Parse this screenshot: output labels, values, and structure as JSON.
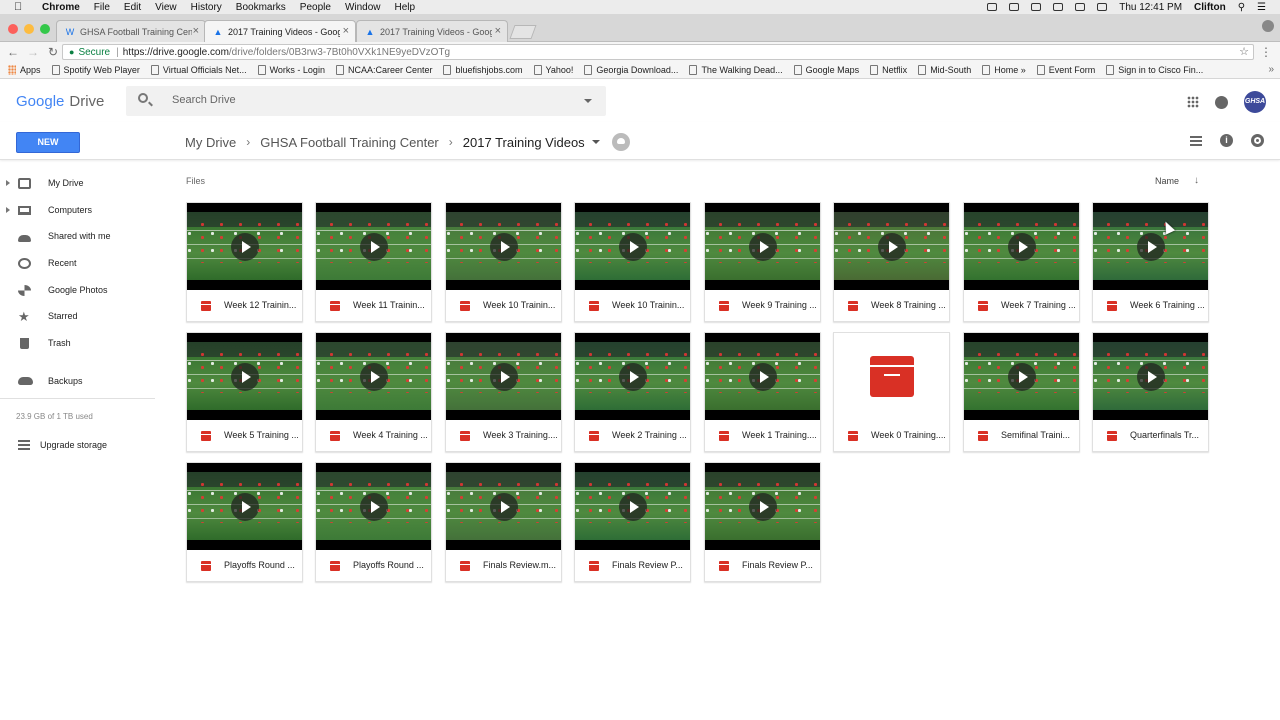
{
  "mac_menubar": {
    "app": "Chrome",
    "items": [
      "File",
      "Edit",
      "View",
      "History",
      "Bookmarks",
      "People",
      "Window",
      "Help"
    ],
    "clock": "Thu 12:41 PM",
    "user": "Clifton"
  },
  "browser": {
    "tabs": [
      {
        "label": "GHSA Football Training Center",
        "active": false
      },
      {
        "label": "2017 Training Videos - Google Drive",
        "active": true
      },
      {
        "label": "2017 Training Videos - Google Drive",
        "active": false
      }
    ],
    "secure_label": "Secure",
    "url_host": "https://drive.google.com",
    "url_path": "/drive/folders/0B3rw3-7Bt0h0VXk1NE9yeDVzOTg"
  },
  "bookmarks": [
    "Apps",
    "Spotify Web Player",
    "Virtual Officials Net...",
    "Works - Login",
    "NCAA:Career Center",
    "bluefishjobs.com",
    "Yahoo!",
    "Georgia Download...",
    "The Walking Dead...",
    "Google Maps",
    "Netflix",
    "Mid-South",
    "Home »",
    "Event Form",
    "Sign in to Cisco Fin..."
  ],
  "drive": {
    "logo_google": "Google",
    "logo_drive": "Drive",
    "search_placeholder": "Search Drive",
    "new_button": "NEW",
    "breadcrumb": [
      "My Drive",
      "GHSA Football Training Center",
      "2017 Training Videos"
    ],
    "avatar_text": "GHSA",
    "sidebar": [
      "My Drive",
      "Computers",
      "Shared with me",
      "Recent",
      "Google Photos",
      "Starred",
      "Trash",
      "Backups"
    ],
    "storage": "23.9 GB of 1 TB used",
    "upgrade": "Upgrade storage",
    "files_label": "Files",
    "sort_label": "Name",
    "files": [
      "Week 12 Trainin...",
      "Week 11 Trainin...",
      "Week 10 Trainin...",
      "Week 10 Trainin...",
      "Week 9 Training ...",
      "Week 8 Training ...",
      "Week 7 Training ...",
      "Week 6 Training ...",
      "Week 5 Training ...",
      "Week 4 Training ...",
      "Week 3 Training....",
      "Week 2 Training ...",
      "Week 1 Training....",
      "Week 0 Training....",
      "Semifinal Traini...",
      "Quarterfinals Tr...",
      "Playoffs Round ...",
      "Playoffs Round ...",
      "Finals Review.m...",
      "Finals Review P...",
      "Finals Review P..."
    ]
  }
}
